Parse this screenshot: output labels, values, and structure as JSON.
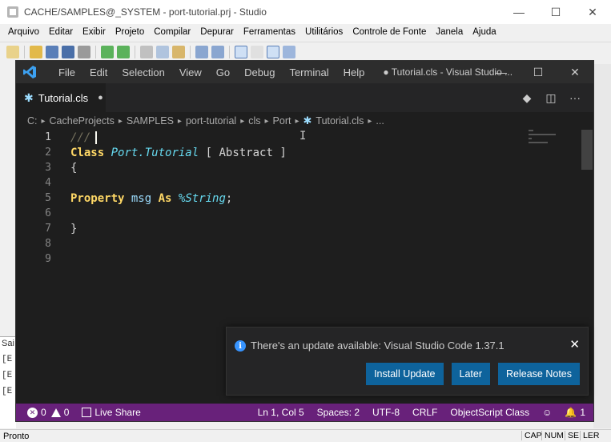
{
  "studio": {
    "title": "CACHE/SAMPLES@_SYSTEM - port-tutorial.prj - Studio",
    "menu": [
      "Arquivo",
      "Editar",
      "Exibir",
      "Projeto",
      "Compilar",
      "Depurar",
      "Ferramentas",
      "Utilitários",
      "Controle de Fonte",
      "Janela",
      "Ajuda"
    ],
    "left_panel_tab": "Sai",
    "left_panel_lines": [
      "[E",
      "[E",
      "[E"
    ],
    "status_text": "Pronto",
    "indicators": [
      "CAP",
      "NUM",
      "SE",
      "LER"
    ]
  },
  "vscode": {
    "menu": [
      "File",
      "Edit",
      "Selection",
      "View",
      "Go",
      "Debug",
      "Terminal",
      "Help"
    ],
    "window_title": "● Tutorial.cls - Visual Studio ...",
    "tab": {
      "label": "Tutorial.cls",
      "dirty": "●"
    },
    "breadcrumb": [
      "C:",
      "CacheProjects",
      "SAMPLES",
      "port-tutorial",
      "cls",
      "Port",
      "Tutorial.cls",
      "..."
    ],
    "lines": [
      {
        "n": "1",
        "tokens": [
          {
            "t": "///",
            "c": "cm"
          }
        ]
      },
      {
        "n": "2",
        "tokens": [
          {
            "t": "Class",
            "c": "kw"
          },
          {
            "t": " ",
            "c": "pn"
          },
          {
            "t": "Port.Tutorial",
            "c": "cls"
          },
          {
            "t": " [ ",
            "c": "pn"
          },
          {
            "t": "Abstract",
            "c": "pn"
          },
          {
            "t": " ]",
            "c": "pn"
          }
        ]
      },
      {
        "n": "3",
        "tokens": [
          {
            "t": "{",
            "c": "pn"
          }
        ]
      },
      {
        "n": "4",
        "tokens": []
      },
      {
        "n": "5",
        "tokens": [
          {
            "t": "Property",
            "c": "kw"
          },
          {
            "t": " ",
            "c": "pn"
          },
          {
            "t": "msg",
            "c": "id"
          },
          {
            "t": " ",
            "c": "pn"
          },
          {
            "t": "As",
            "c": "kw"
          },
          {
            "t": " ",
            "c": "pn"
          },
          {
            "t": "%String",
            "c": "typ"
          },
          {
            "t": ";",
            "c": "pn"
          }
        ]
      },
      {
        "n": "6",
        "tokens": []
      },
      {
        "n": "7",
        "tokens": [
          {
            "t": "}",
            "c": "pn"
          }
        ]
      },
      {
        "n": "8",
        "tokens": []
      },
      {
        "n": "9",
        "tokens": []
      }
    ],
    "notification": {
      "message": "There's an update available: Visual Studio Code 1.37.1",
      "buttons": [
        "Install Update",
        "Later",
        "Release Notes"
      ]
    },
    "status": {
      "errors": "0",
      "warnings": "0",
      "live_share": "Live Share",
      "position": "Ln 1, Col 5",
      "spaces": "Spaces: 2",
      "encoding": "UTF-8",
      "eol": "CRLF",
      "language": "ObjectScript Class",
      "notifications": "1"
    },
    "colors": {
      "accent": "#68217a",
      "button": "#0e639c",
      "info": "#3794ff"
    }
  }
}
